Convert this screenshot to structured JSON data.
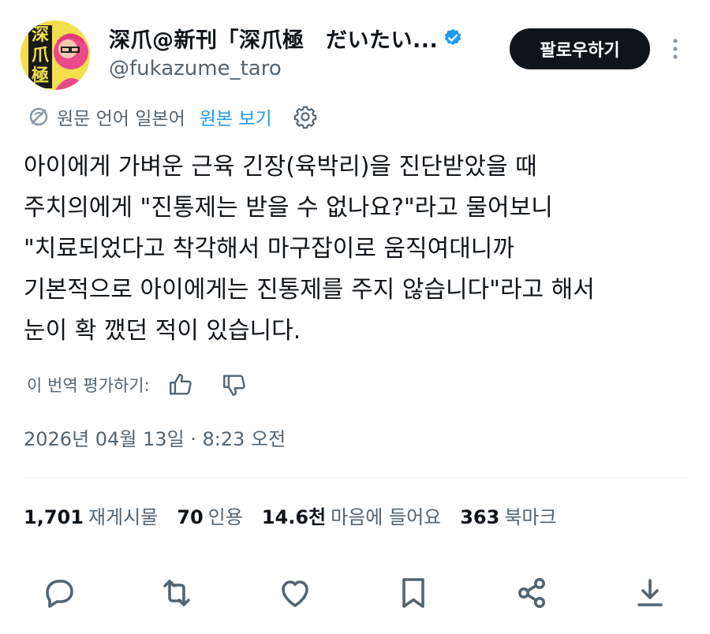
{
  "header": {
    "avatar_text": "深爪極",
    "display_name": "深爪@新刊「深爪極　だいたい...",
    "handle": "@fukazume_taro",
    "follow_label": "팔로우하기"
  },
  "translation": {
    "source_text": "원문 언어 일본어",
    "show_original_label": "원본 보기"
  },
  "tweet": {
    "lines": [
      "아이에게 가벼운 근육 긴장(육박리)을 진단받았을 때",
      "주치의에게 \"진통제는 받을 수 없나요?\"라고 물어보니",
      "\"치료되었다고 착각해서 마구잡이로 움직여대니까",
      "기본적으로 아이에게는 진통제를 주지 않습니다\"라고 해서",
      "눈이 확 깼던 적이 있습니다."
    ]
  },
  "rate": {
    "label": "이 번역 평가하기:"
  },
  "timestamp": "2026년 04월 13일 · 8:23 오전",
  "stats": [
    {
      "value": "1,701",
      "label": "재게시물"
    },
    {
      "value": "70",
      "label": "인용"
    },
    {
      "value": "14.6천",
      "label": "마음에 들어요"
    },
    {
      "value": "363",
      "label": "북마크"
    }
  ],
  "colors": {
    "accent": "#1d9bf0",
    "text": "#0f1419",
    "muted": "#536471",
    "button_bg": "#0f1419"
  },
  "icons": [
    "translate-icon",
    "gear-icon",
    "thumbs-up-icon",
    "thumbs-down-icon",
    "reply-icon",
    "repost-icon",
    "like-icon",
    "bookmark-icon",
    "share-icon",
    "download-icon",
    "verified-badge-icon",
    "more-icon"
  ]
}
